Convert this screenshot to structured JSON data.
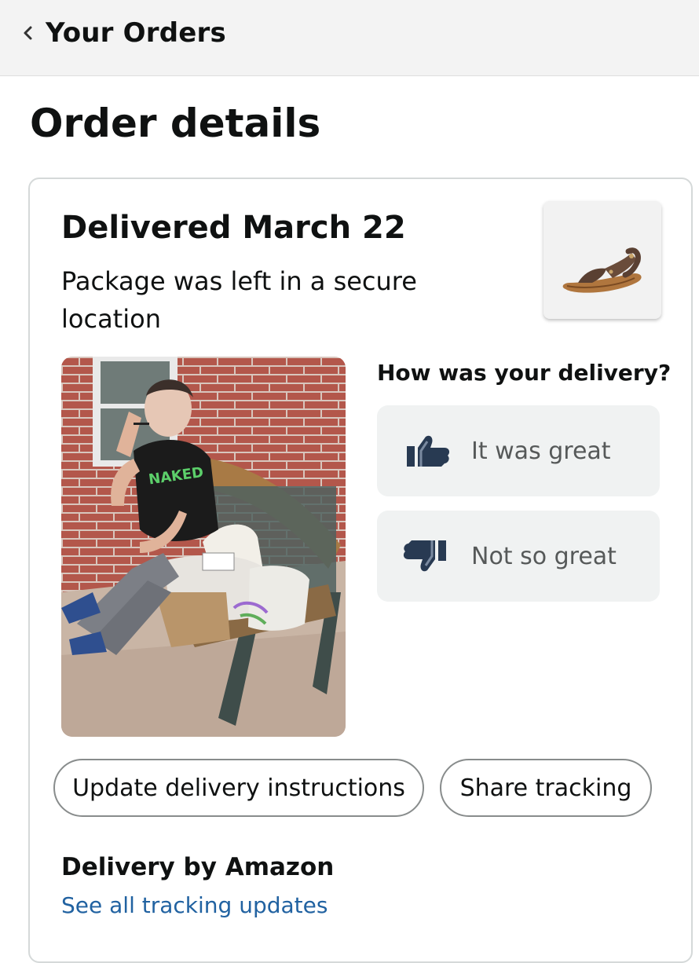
{
  "header": {
    "back_label": "Your Orders"
  },
  "page": {
    "title": "Order details"
  },
  "shipment": {
    "status_title": "Delivered March 22",
    "status_detail": "Package was left in a secure location",
    "product_image_icon": "sandal-image"
  },
  "delivery_photo": {
    "icon": "delivery-photo-image",
    "shirt_text": "NAKED"
  },
  "feedback": {
    "question": "How was your delivery?",
    "great_label": "It was great",
    "bad_label": "Not so great",
    "great_icon": "thumbs-up-icon",
    "bad_icon": "thumbs-down-icon"
  },
  "actions": {
    "update_instructions_label": "Update delivery instructions",
    "share_tracking_label": "Share tracking"
  },
  "carrier": {
    "delivery_by": "Delivery by Amazon",
    "tracking_link": "See all tracking updates"
  },
  "colors": {
    "link": "#2162a1",
    "button_bg": "#f0f2f2",
    "header_bg": "#f3f3f3"
  }
}
